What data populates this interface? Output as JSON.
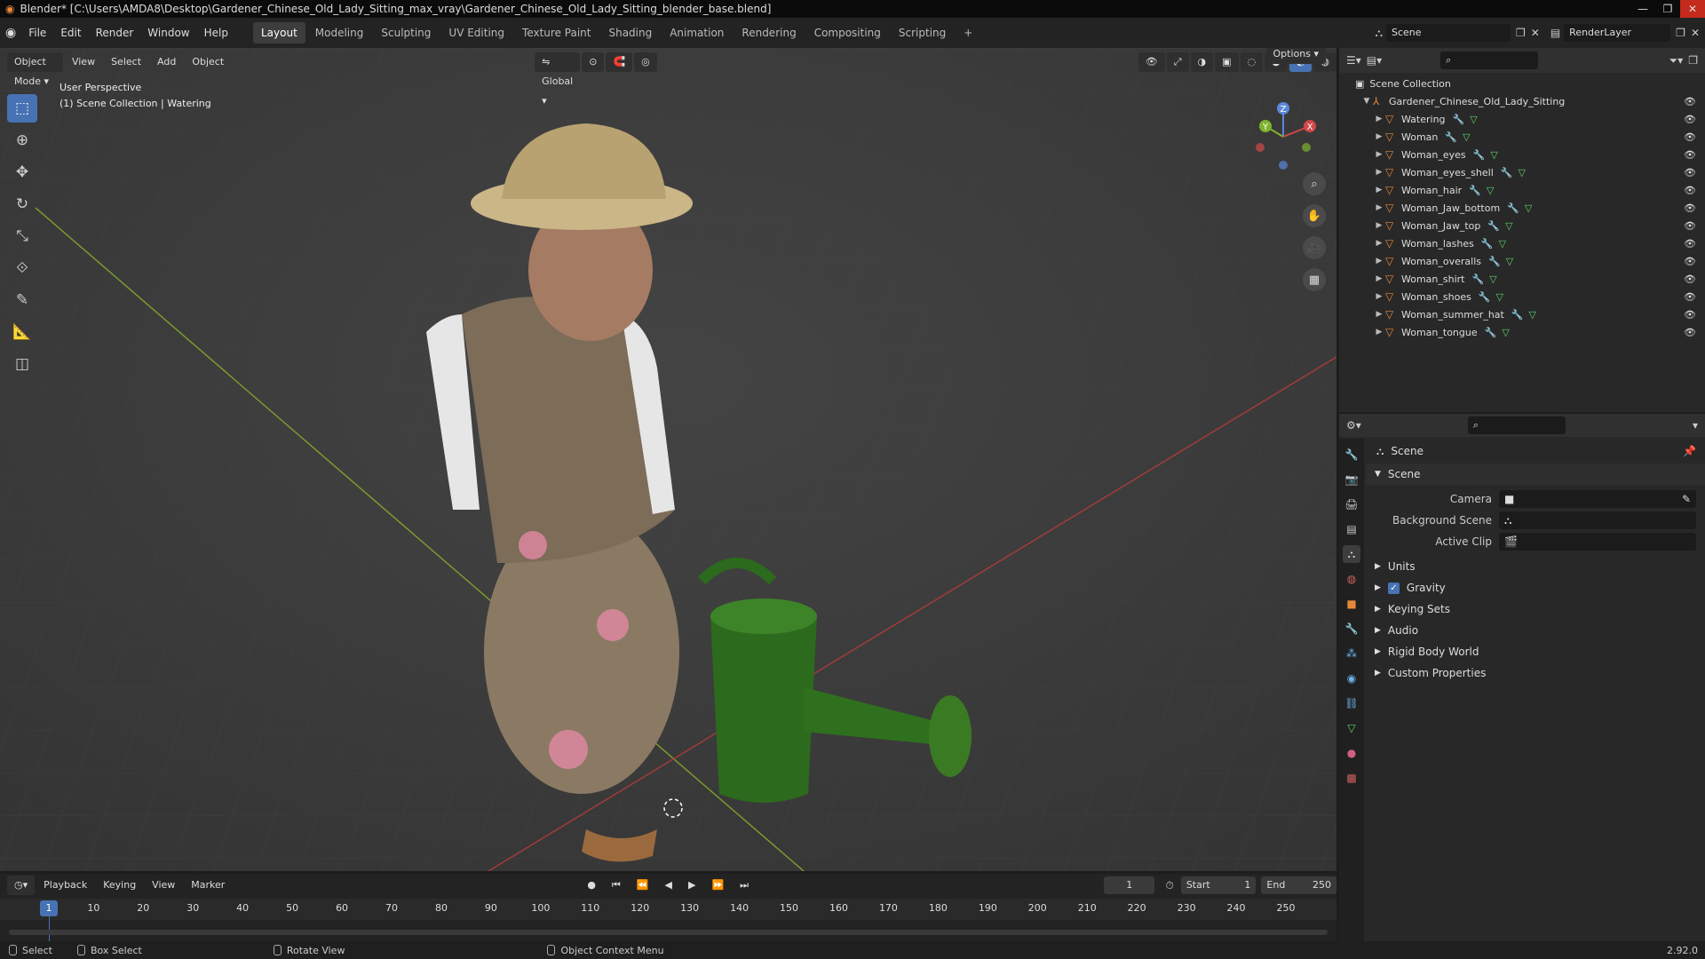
{
  "window": {
    "title": "Blender* [C:\\Users\\AMDA8\\Desktop\\Gardener_Chinese_Old_Lady_Sitting_max_vray\\Gardener_Chinese_Old_Lady_Sitting_blender_base.blend]",
    "minimize": "—",
    "maximize": "❐",
    "close": "✕"
  },
  "menu": [
    "File",
    "Edit",
    "Render",
    "Window",
    "Help"
  ],
  "workspaces": [
    "Layout",
    "Modeling",
    "Sculpting",
    "UV Editing",
    "Texture Paint",
    "Shading",
    "Animation",
    "Rendering",
    "Compositing",
    "Scripting"
  ],
  "workspace_add": "+",
  "scene_selector": {
    "value": "Scene"
  },
  "view_layer": {
    "value": "RenderLayer"
  },
  "viewport": {
    "mode": "Object Mode",
    "menus": [
      "View",
      "Select",
      "Add",
      "Object"
    ],
    "transform_orientation": "Global",
    "options": "Options",
    "overlay_line1": "User Perspective",
    "overlay_line2": "(1) Scene Collection | Watering",
    "gizmo": {
      "x": "X",
      "y": "Y",
      "z": "Z"
    }
  },
  "outliner": {
    "root": "Scene Collection",
    "collection": "Gardener_Chinese_Old_Lady_Sitting",
    "objects": [
      "Watering",
      "Woman",
      "Woman_eyes",
      "Woman_eyes_shell",
      "Woman_hair",
      "Woman_Jaw_bottom",
      "Woman_Jaw_top",
      "Woman_lashes",
      "Woman_overalls",
      "Woman_shirt",
      "Woman_shoes",
      "Woman_summer_hat",
      "Woman_tongue"
    ]
  },
  "properties": {
    "header": "Scene",
    "panel": "Scene",
    "fields": [
      {
        "label": "Camera",
        "value": ""
      },
      {
        "label": "Background Scene",
        "value": ""
      },
      {
        "label": "Active Clip",
        "value": ""
      }
    ],
    "subpanels": [
      "Units",
      "Gravity",
      "Keying Sets",
      "Audio",
      "Rigid Body World",
      "Custom Properties"
    ],
    "gravity_checked": true
  },
  "timeline": {
    "menus": [
      "Playback",
      "Keying",
      "View",
      "Marker"
    ],
    "current_frame": "1",
    "start_label": "Start",
    "start": "1",
    "end_label": "End",
    "end": "250",
    "ticks": [
      "1",
      "10",
      "20",
      "30",
      "40",
      "50",
      "60",
      "70",
      "80",
      "90",
      "100",
      "110",
      "120",
      "130",
      "140",
      "150",
      "160",
      "170",
      "180",
      "190",
      "200",
      "210",
      "220",
      "230",
      "240",
      "250"
    ]
  },
  "status": {
    "select": "Select",
    "box_select": "Box Select",
    "rotate_view": "Rotate View",
    "context_menu": "Object Context Menu",
    "version": "2.92.0"
  }
}
